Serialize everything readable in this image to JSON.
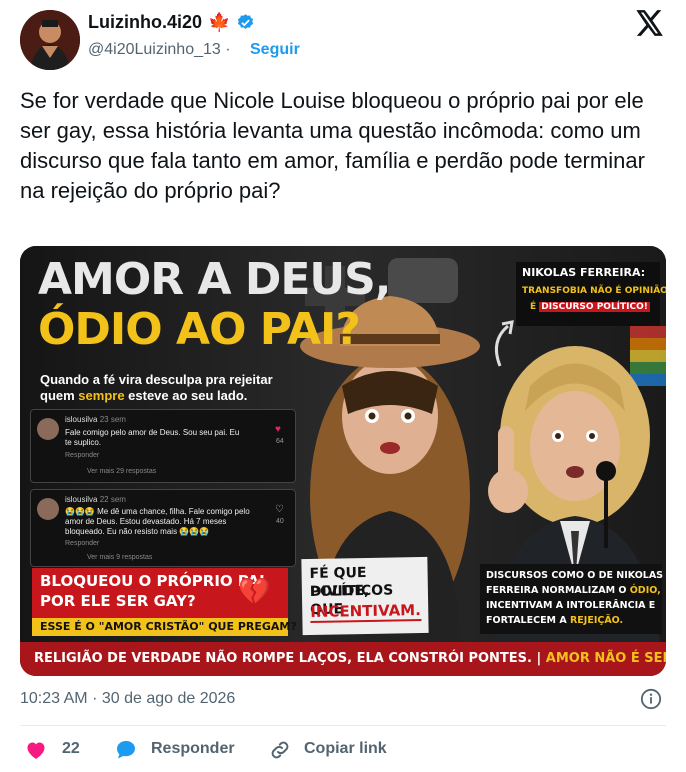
{
  "header": {
    "display_name": "Luizinho.4i20",
    "flag": "🍁",
    "handle": "@4i20Luizinho_13",
    "separator": "·",
    "follow_label": "Seguir"
  },
  "tweet": {
    "text": "Se for verdade que Nicole Louise bloqueou o próprio pai por ele ser gay, essa história levanta uma questão incômoda: como um discurso que fala tanto em amor, família e perdão pode terminar na rejeição do próprio pai?"
  },
  "media": {
    "headline_line1": "AMOR A DEUS,",
    "headline_line2": "ÓDIO AO PAI?",
    "subhead_part1": "Quando a fé vira desculpa pra rejeitar",
    "subhead_part2a": "quem ",
    "subhead_highlight": "sempre",
    "subhead_part2b": " esteve ao seu lado.",
    "comment1_user": "islousilva",
    "comment1_time": "23 sem",
    "comment1_text": "Fale comigo pelo amor de Deus. Sou seu pai. Eu te suplico.",
    "comment1_reply": "Responder",
    "comment1_likes": "64",
    "comment1_more": "Ver mais 29 respostas",
    "comment2_user": "islousilva",
    "comment2_time": "22 sem",
    "comment2_emojis": "😭😭😭",
    "comment2_text": "Me dê uma chance, filha. Fale comigo pelo amor de Deus. Estou devastado. Há 7 meses bloqueado. Eu não resisto mais",
    "comment2_reply": "Responder",
    "comment2_likes": "40",
    "comment2_more": "Ver mais 9 respostas",
    "box_red_line1": "BLOQUEOU O PRÓPRIO PAI",
    "box_red_line2": "POR ELE SER GAY?",
    "box_yellow": "ESSE É O \"AMOR CRISTÃO\" QUE PREGAM?",
    "box_white_line1": "FÉ QUE DIVIDE,",
    "box_white_line2": "POLÍTICOS QUE",
    "box_white_line3": "INCENTIVAM.",
    "nikolas_title": "NIKOLAS FERREIRA:",
    "nikolas_line1": "TRANSFOBIA NÃO É OPINIÃO,",
    "nikolas_line2a": "É ",
    "nikolas_line2b": "DISCURSO POLÍTICO!",
    "right_text_line1": "DISCURSOS COMO O DE NIKOLAS",
    "right_text_line2a": "FERREIRA NORMALIZAM O ",
    "right_text_line2b": "ÓDIO,",
    "right_text_line3": "INCENTIVAM A INTOLERÂNCIA E",
    "right_text_line4a": "FORTALECEM A ",
    "right_text_line4b": "REJEIÇÃO.",
    "bottom_banner_a": "RELIGIÃO DE VERDADE NÃO ROMPE LAÇOS, ELA CONSTRÓI PONTES. | ",
    "bottom_banner_b": "AMOR NÃO É SELETIVO."
  },
  "footer": {
    "time": "10:23 AM",
    "separator": "·",
    "date": "30 de ago de 2026"
  },
  "actions": {
    "likes": "22",
    "reply_label": "Responder",
    "copy_label": "Copiar link"
  },
  "colors": {
    "accent": "#1d9bf0",
    "like": "#f91880",
    "text_secondary": "#536471",
    "media_red": "#c8161d",
    "media_yellow": "#f2c21a"
  }
}
